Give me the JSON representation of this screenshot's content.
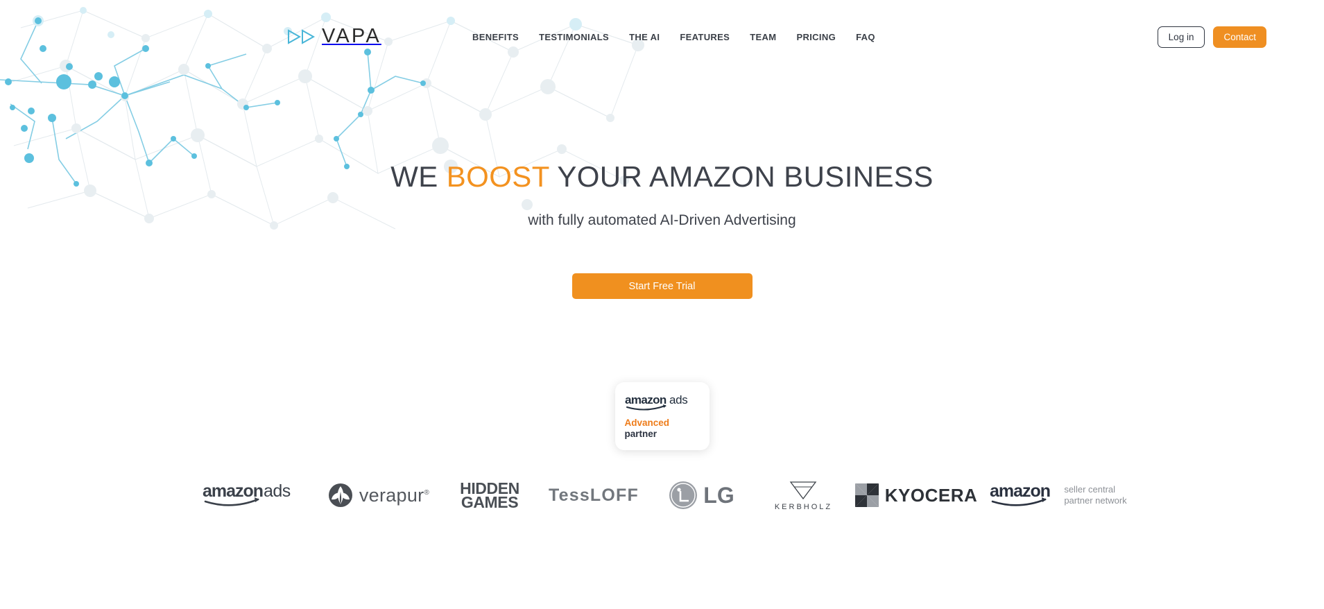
{
  "brand": {
    "name": "VAPA",
    "mark": "double-triangle-play-icon",
    "mark_color": "#49b6d8"
  },
  "nav": {
    "items": [
      {
        "label": "BENEFITS",
        "name": "nav-benefits"
      },
      {
        "label": "TESTIMONIALS",
        "name": "nav-testimonials"
      },
      {
        "label": "THE AI",
        "name": "nav-the-ai"
      },
      {
        "label": "FEATURES",
        "name": "nav-features"
      },
      {
        "label": "TEAM",
        "name": "nav-team"
      },
      {
        "label": "PRICING",
        "name": "nav-pricing"
      },
      {
        "label": "FAQ",
        "name": "nav-faq"
      }
    ]
  },
  "header_actions": {
    "login_label": "Log in",
    "contact_label": "Contact",
    "contact_color": "#ef8f22"
  },
  "hero": {
    "title_before": "WE ",
    "title_accent": "BOOST",
    "title_after": " YOUR AMAZON BUSINESS",
    "accent_color": "#f39220",
    "subtitle": "with fully automated AI-Driven Advertising",
    "cta_label": "Start Free Trial",
    "cta_color": "#f0901f"
  },
  "partner_badge": {
    "logo_text_bold": "amazon",
    "logo_text_light": "ads",
    "tier": "Advanced",
    "tier_suffix": "partner",
    "tier_color": "#ee7c1a"
  },
  "clients": {
    "logos": [
      {
        "name": "client-logo-amazon-ads",
        "label": "amazon ads"
      },
      {
        "name": "client-logo-verapur",
        "label": "verapur"
      },
      {
        "name": "client-logo-hidden-games",
        "label": "HIDDEN GAMES"
      },
      {
        "name": "client-logo-tessloff",
        "label": "TESSLOFF"
      },
      {
        "name": "client-logo-lg",
        "label": "LG"
      },
      {
        "name": "client-logo-kerbholz",
        "label": "KERBHOLZ"
      },
      {
        "name": "client-logo-kyocera",
        "label": "KYOCERA"
      },
      {
        "name": "client-logo-amazon-seller-central",
        "label": "amazon seller central partner network"
      }
    ],
    "amazon_ads_bold": "amazon",
    "amazon_ads_light": "ads",
    "verapur_text": "verapur",
    "verapur_mark": "leaf-circle-icon",
    "hidden_games_line1": "HIDDEN",
    "hidden_games_line2": "GAMES",
    "tessloff_text": "TessLOFF",
    "lg_text": "LG",
    "lg_mark": "lg-face-circle-icon",
    "kerbholz_text": "KERBHOLZ",
    "kerbholz_mark": "inverted-triangle-icon",
    "kyocera_text": "KYOCERA",
    "kyocera_mark": "pinwheel-diamond-icon",
    "scpn_amazon": "amazon",
    "scpn_lines": "seller central\npartner network"
  }
}
